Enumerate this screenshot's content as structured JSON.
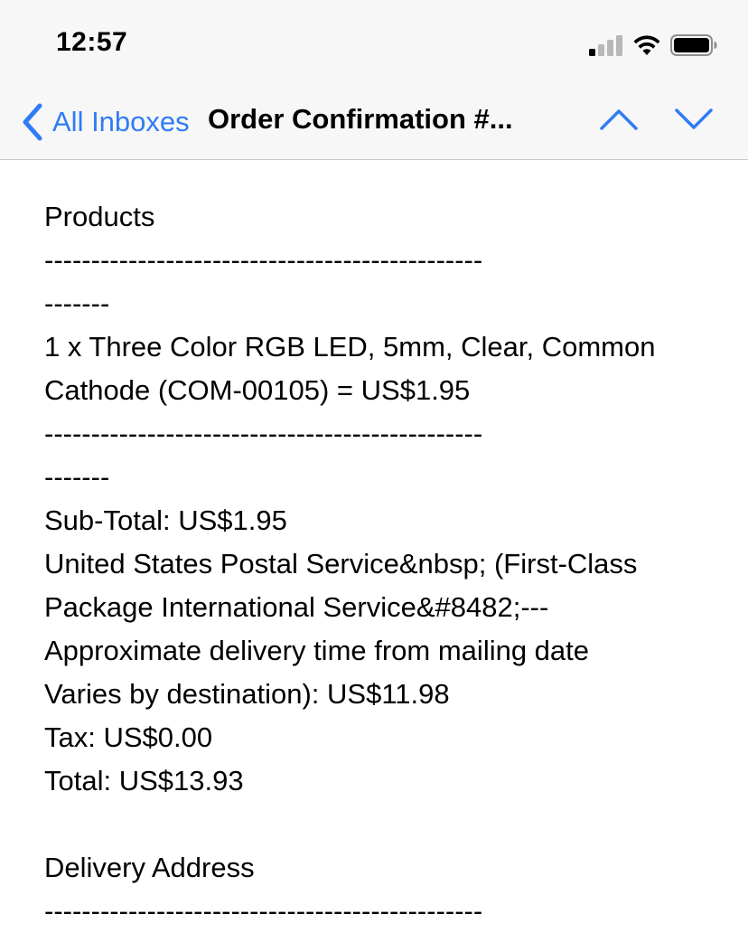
{
  "status_bar": {
    "time": "12:57"
  },
  "nav": {
    "back_label": "All Inboxes",
    "title": "Order Confirmation #...",
    "accent_color": "#2f7cf6"
  },
  "email": {
    "products_heading": "Products",
    "divider_1a": "-----------------------------------------------",
    "divider_1b": "-------",
    "product_line_1": "1 x Three Color RGB LED, 5mm, Clear, Common",
    "product_line_2": "Cathode (COM-00105) = US$1.95",
    "divider_2a": "-----------------------------------------------",
    "divider_2b": "-------",
    "subtotal": "Sub-Total: US$1.95",
    "shipping_line_1": "United States Postal Service&nbsp; (First-Class",
    "shipping_line_2": "Package International Service&#8482;---",
    "shipping_line_3": "Approximate delivery time from mailing date",
    "shipping_line_4": "Varies by destination): US$11.98",
    "tax": "Tax: US$0.00",
    "total": "Total: US$13.93",
    "delivery_heading": "Delivery Address",
    "divider_3a": "-----------------------------------------------"
  }
}
